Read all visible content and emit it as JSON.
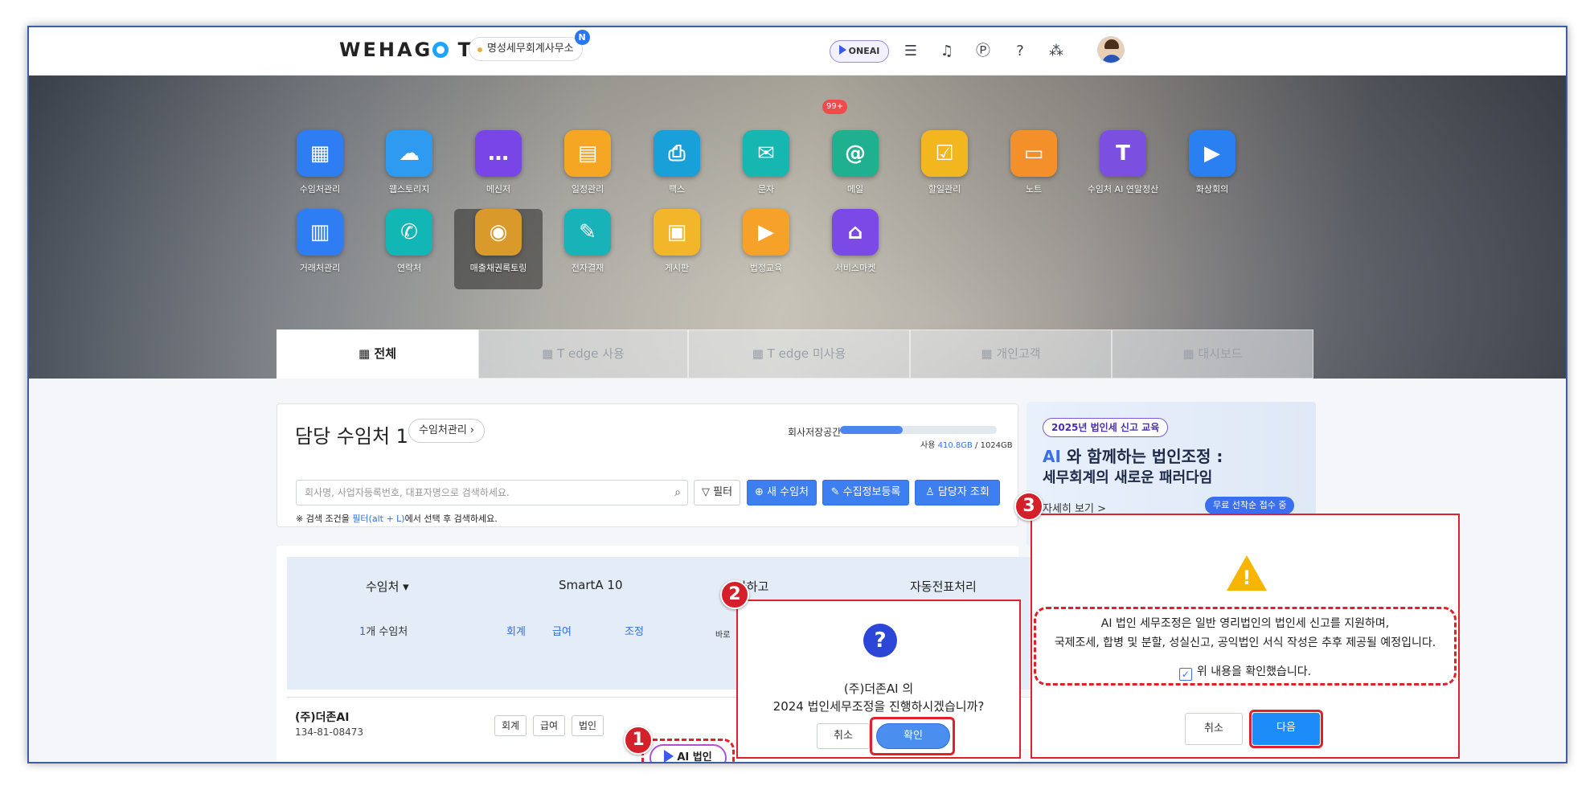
{
  "topbar": {
    "logo": "WEHAGO T",
    "logo_pre": "WEHAG",
    "logo_post": "T",
    "office": "명성세무회계사무소",
    "office_badge": "N",
    "oneai": "ONEAI",
    "icons": [
      "note-icon",
      "bell-icon",
      "point-icon",
      "help-icon",
      "org-icon"
    ]
  },
  "apps_row1": [
    {
      "label": "수임처관리",
      "color": "#2e7df2",
      "icon": "building-icon",
      "glyph": "▦"
    },
    {
      "label": "웹스토리지",
      "color": "#2f9bf0",
      "icon": "cloud-icon",
      "glyph": "☁"
    },
    {
      "label": "메신저",
      "color": "#7a45e6",
      "icon": "chat-icon",
      "glyph": "…"
    },
    {
      "label": "일정관리",
      "color": "#f5a623",
      "icon": "calendar-icon",
      "glyph": "▤"
    },
    {
      "label": "팩스",
      "color": "#1aa0d8",
      "icon": "fax-icon",
      "glyph": "⎙"
    },
    {
      "label": "문자",
      "color": "#16b7b0",
      "icon": "sms-icon",
      "glyph": "✉"
    },
    {
      "label": "메일",
      "color": "#1fb08f",
      "icon": "mail-icon",
      "glyph": "@"
    },
    {
      "label": "할일관리",
      "color": "#f2b61f",
      "icon": "todo-icon",
      "glyph": "☑"
    },
    {
      "label": "노트",
      "color": "#f4902a",
      "icon": "note-app-icon",
      "glyph": "▭"
    },
    {
      "label": "수임처 AI 연말정산",
      "color": "#7b4fe0",
      "icon": "tax-icon",
      "glyph": "T"
    },
    {
      "label": "화상회의",
      "color": "#2a80f0",
      "icon": "video-icon",
      "glyph": "▶"
    }
  ],
  "apps_row2": [
    {
      "label": "거래처관리",
      "color": "#2e7df2",
      "icon": "office-icon",
      "glyph": "▥"
    },
    {
      "label": "연락처",
      "color": "#12b7b5",
      "icon": "phone-icon",
      "glyph": "✆"
    },
    {
      "label": "매출채권록토링",
      "color": "#d99a2b",
      "icon": "frog-icon",
      "glyph": "◉"
    },
    {
      "label": "전자결재",
      "color": "#18b3b8",
      "icon": "approval-icon",
      "glyph": "✎"
    },
    {
      "label": "게시판",
      "color": "#f3b52a",
      "icon": "board-icon",
      "glyph": "▣"
    },
    {
      "label": "법정교육",
      "color": "#f6a12a",
      "icon": "education-icon",
      "glyph": "▶"
    },
    {
      "label": "서비스마켓",
      "color": "#7b49e5",
      "icon": "store-icon",
      "glyph": "⌂"
    }
  ],
  "mail_badge": "99+",
  "tabs": [
    "전체",
    "T edge 사용",
    "T edge 미사용",
    "개인고객",
    "대시보드"
  ],
  "main": {
    "title": "담당 수임처 1",
    "manage_btn": "수임처관리 ›",
    "storage_label": "회사저장공간",
    "storage_fraction": 0.4,
    "storage_used_label": "사용",
    "storage_used": "410.8GB",
    "storage_total": "/ 1024GB",
    "search_placeholder": "회사명, 사업자등록번호, 대표자명으로 검색하세요.",
    "filter_btn": "필터",
    "new_btn": "새 수임처",
    "collect_btn": "수집정보등록",
    "manager_btn": "담당자 조회",
    "hint_pre": "※ 검색 조건을 ",
    "hint_link": "필터(alt + L)",
    "hint_post": "에서 선택 후 검색하세요."
  },
  "table": {
    "col1": "수임처 ▾",
    "col2": "SmartA 10",
    "col3": "나하고",
    "col4": "자동전표처리",
    "count": "개 수임처",
    "count_num": "1",
    "sub1": "회계",
    "sub2": "급여",
    "sub3": "조정",
    "sub4": "바로",
    "row_name": "(주)더존AI",
    "row_reg": "134-81-08473",
    "row_tag1": "회계",
    "row_tag2": "급여",
    "row_tag3": "법인",
    "ai_btn": "AI 법인"
  },
  "banner": {
    "pill": "2025년 법인세 신고 교육",
    "title_ai": "AI",
    "title_rest": " 와 함께하는 법인조정 :",
    "title2": "세무회계의 새로운 패러다임",
    "link": "자세히 보기 >",
    "free": "무료 선착순 접수 중"
  },
  "dialog2": {
    "line1": "(주)더존AI 의",
    "line2": "2024 법인세무조정을 진행하시겠습니까?",
    "cancel": "취소",
    "ok": "확인"
  },
  "dialog3": {
    "line1": "AI 법인 세무조정은 일반 영리법인의 법인세 신고를 지원하며,",
    "line2": "국제조세, 합병 및 분할, 성실신고, 공익법인 서식 작성은 추후 제공될 예정입니다.",
    "check": "위 내용을 확인했습니다.",
    "cancel": "취소",
    "next": "다음"
  },
  "steps": [
    "1",
    "2",
    "3"
  ],
  "colors": {
    "accent": "#3d7ef0",
    "highlight": "#e0202a",
    "warning": "#f7b500"
  }
}
